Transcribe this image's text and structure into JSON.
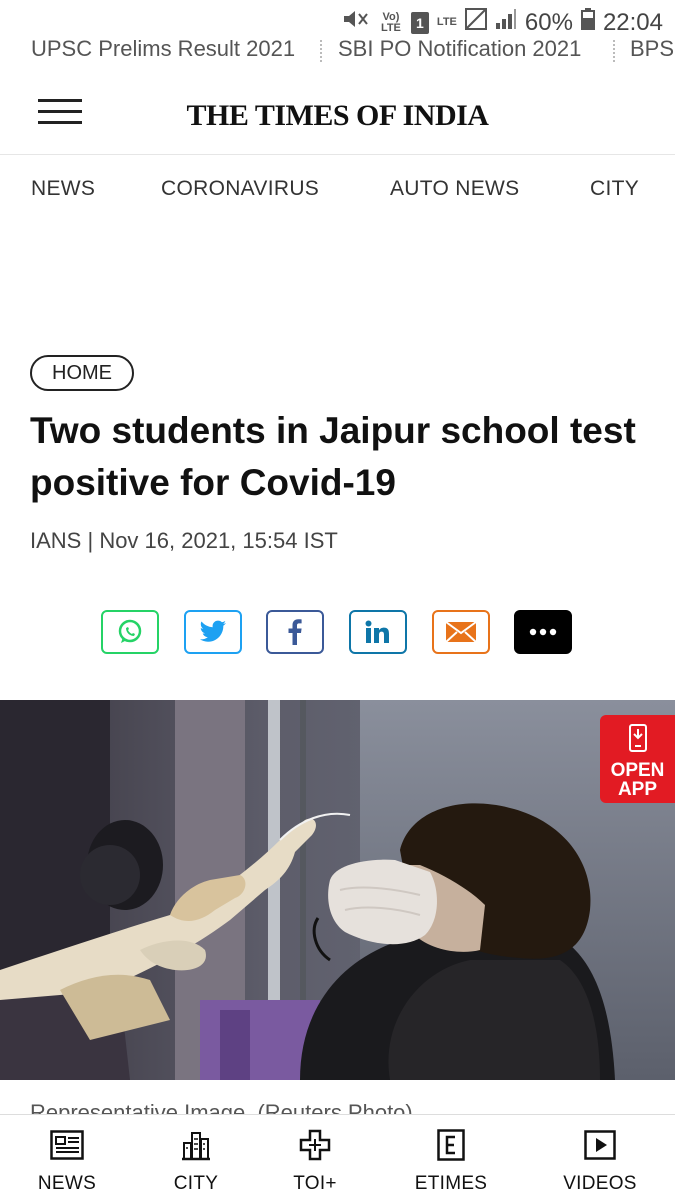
{
  "status_bar": {
    "volte": "Vo) LTE",
    "sim": "1",
    "lte": "LTE",
    "battery": "60%",
    "time": "22:04"
  },
  "ticker": [
    "UPSC Prelims Result 2021",
    "SBI PO Notification 2021",
    "BPS"
  ],
  "header": {
    "logo": "THE TIMES OF INDIA"
  },
  "nav": [
    "NEWS",
    "CORONAVIRUS",
    "AUTO NEWS",
    "CITY"
  ],
  "article": {
    "breadcrumb": "HOME",
    "headline": "Two students in Jaipur school test positive for Covid-19",
    "source": "IANS",
    "date": "Nov 16, 2021, 15:54 IST",
    "caption": "Representative Image. (Reuters Photo)"
  },
  "share": [
    {
      "name": "whatsapp-icon",
      "color": "#25d366"
    },
    {
      "name": "twitter-icon",
      "color": "#1da1f2"
    },
    {
      "name": "facebook-icon",
      "color": "#3b5998"
    },
    {
      "name": "linkedin-icon",
      "color": "#0e76a8"
    },
    {
      "name": "email-icon",
      "color": "#e8731a"
    },
    {
      "name": "more-icon",
      "color": "#000000"
    }
  ],
  "open_app": {
    "line1": "OPEN",
    "line2": "APP",
    "color": "#e21b23"
  },
  "bottom_nav": [
    {
      "label": "NEWS",
      "icon": "news-icon"
    },
    {
      "label": "CITY",
      "icon": "city-icon"
    },
    {
      "label": "TOI+",
      "icon": "toi-plus-icon"
    },
    {
      "label": "ETIMES",
      "icon": "etimes-icon"
    },
    {
      "label": "VIDEOS",
      "icon": "videos-icon"
    }
  ]
}
